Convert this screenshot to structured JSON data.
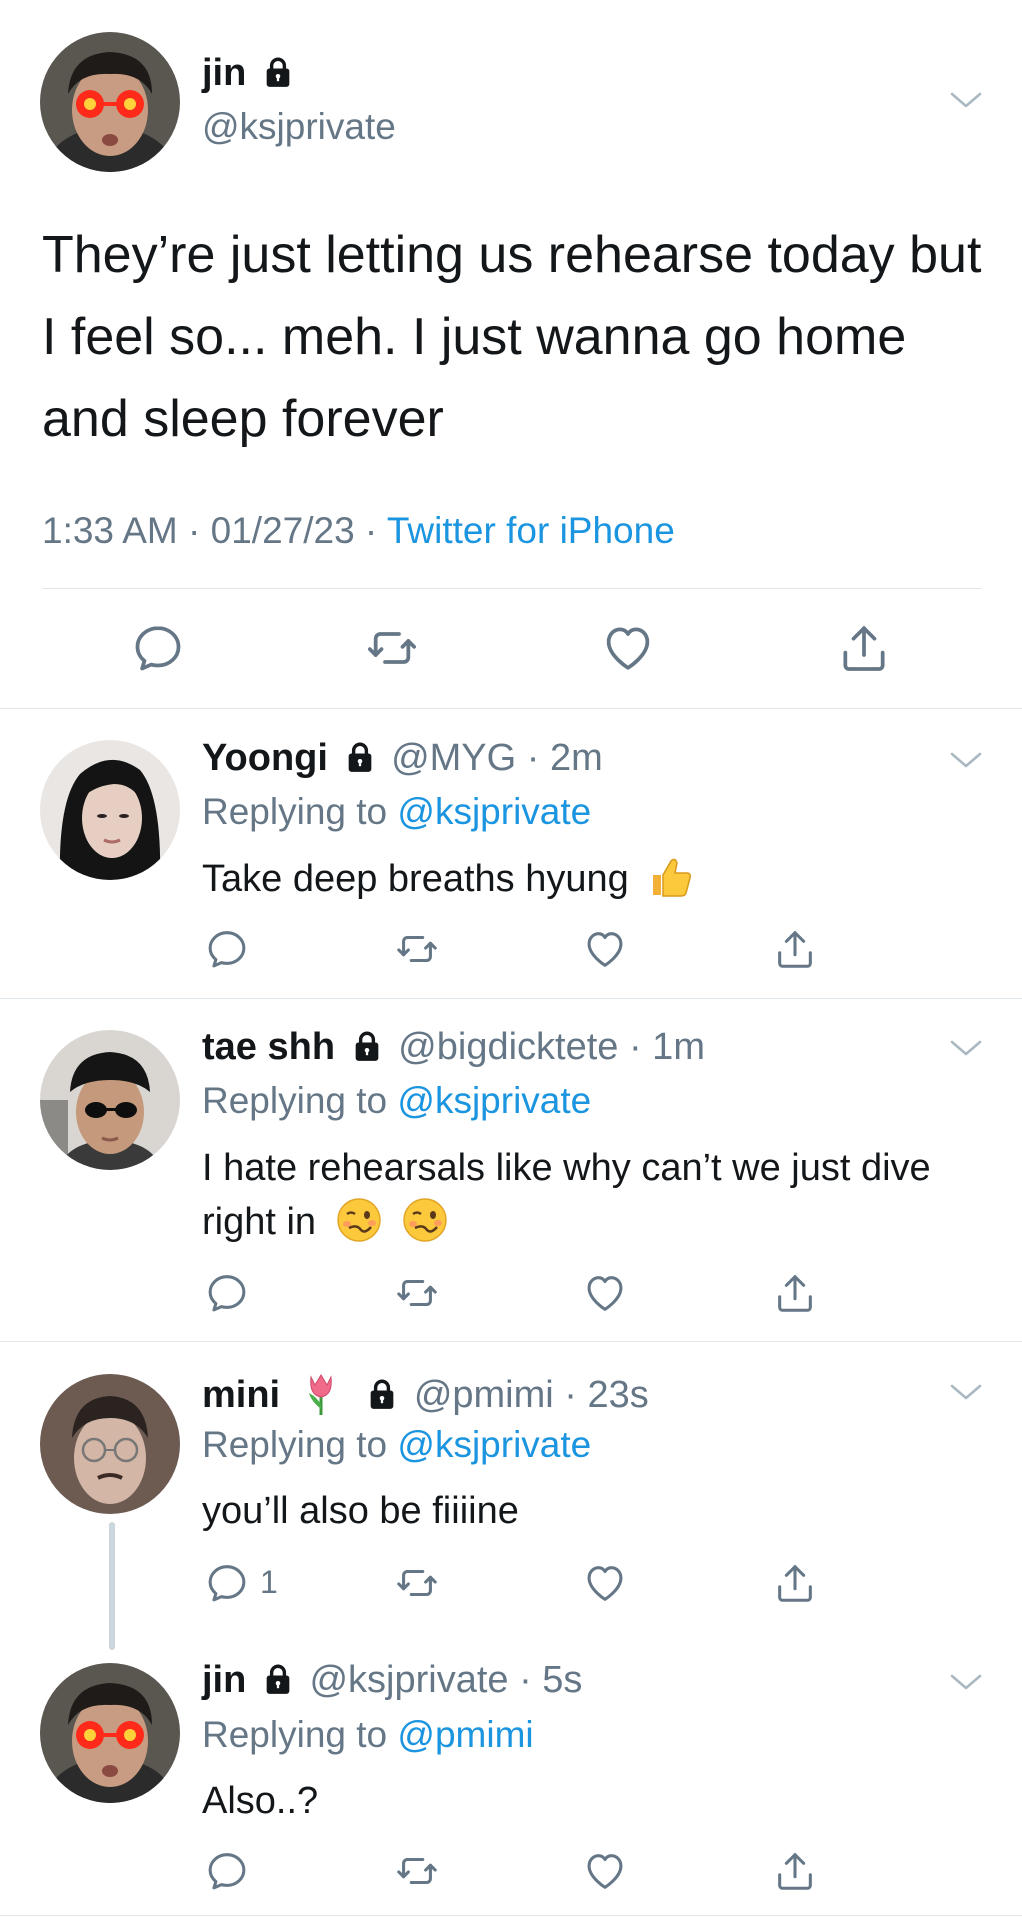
{
  "main_tweet": {
    "name": "jin",
    "handle": "@ksjprivate",
    "text": "They’re just letting us rehearse today but I feel so... meh. I just wanna go home and sleep forever",
    "time": "1:33 AM · 01/27/23 · ",
    "source": "Twitter for iPhone"
  },
  "replies": [
    {
      "name": "Yoongi",
      "handle_time": "@MYG · 2m",
      "replying_prefix": "Replying to ",
      "replying_to": "@ksjprivate",
      "text": "Take deep breaths hyung"
    },
    {
      "name": "tae shh",
      "handle_time": "@bigdicktete · 1m",
      "replying_prefix": "Replying to ",
      "replying_to": "@ksjprivate",
      "text": "I hate rehearsals like why can’t we just dive right in"
    },
    {
      "name": "mini",
      "handle_time": "@pmimi · 23s",
      "replying_prefix": "Replying to ",
      "replying_to": "@ksjprivate",
      "text": "you’ll also be fiiiine",
      "reply_count": "1"
    },
    {
      "name": "jin",
      "handle_time": "@ksjprivate · 5s",
      "replying_prefix": "Replying to ",
      "replying_to": "@pmimi",
      "text": "Also..?"
    }
  ],
  "colors": {
    "link": "#1b95e0",
    "secondary": "#657786",
    "divider": "#e1e8ed",
    "thread_line": "#ccd6dd"
  },
  "icons": [
    "reply-icon",
    "retweet-icon",
    "like-icon",
    "share-icon",
    "lock-icon",
    "chevron-down-icon"
  ]
}
